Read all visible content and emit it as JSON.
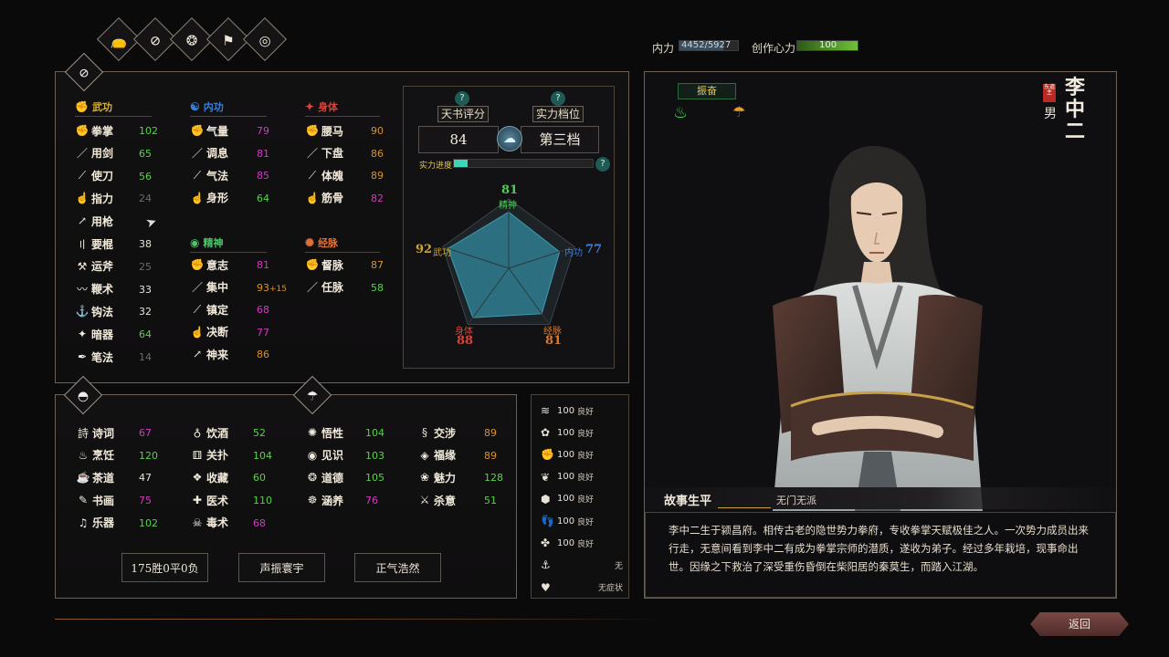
{
  "top_tabs": [
    {
      "icon": "pouch-icon",
      "glyph": "👝"
    },
    {
      "icon": "forbidden-scroll-icon",
      "glyph": "⊘"
    },
    {
      "icon": "stones-icon",
      "glyph": "❂"
    },
    {
      "icon": "flags-icon",
      "glyph": "⚑"
    },
    {
      "icon": "target-icon",
      "glyph": "◎"
    }
  ],
  "resources": {
    "neili_label": "内力",
    "neili_value": "4452/5927",
    "neili_fraction": 0.75,
    "creation_label": "创作心力",
    "creation_value": "100",
    "creation_fraction": 1.0
  },
  "martial": {
    "title": "武功",
    "items": [
      {
        "name": "拳掌",
        "value": "102",
        "tone": "g"
      },
      {
        "name": "用剑",
        "value": "65",
        "tone": "g"
      },
      {
        "name": "使刀",
        "value": "56",
        "tone": "g"
      },
      {
        "name": "指力",
        "value": "24",
        "tone": "d"
      },
      {
        "name": "用枪",
        "value": "",
        "tone": "d"
      },
      {
        "name": "要棍",
        "value": "38",
        "tone": "w"
      },
      {
        "name": "运斧",
        "value": "25",
        "tone": "d"
      },
      {
        "name": "鞭术",
        "value": "33",
        "tone": "w"
      },
      {
        "name": "钩法",
        "value": "32",
        "tone": "w"
      },
      {
        "name": "暗器",
        "value": "64",
        "tone": "g"
      },
      {
        "name": "笔法",
        "value": "14",
        "tone": "d"
      }
    ]
  },
  "neigong": {
    "title": "内功",
    "items": [
      {
        "name": "气量",
        "value": "79",
        "tone": "p"
      },
      {
        "name": "调息",
        "value": "81",
        "tone": "p"
      },
      {
        "name": "气法",
        "value": "85",
        "tone": "p"
      },
      {
        "name": "身形",
        "value": "64",
        "tone": "g"
      }
    ]
  },
  "jingshen": {
    "title": "精神",
    "items": [
      {
        "name": "意志",
        "value": "81",
        "tone": "p"
      },
      {
        "name": "集中",
        "value": "93",
        "bonus": "+15",
        "tone": "o"
      },
      {
        "name": "镇定",
        "value": "68",
        "tone": "p"
      },
      {
        "name": "决断",
        "value": "77",
        "tone": "p"
      },
      {
        "name": "神来",
        "value": "86",
        "tone": "o"
      }
    ]
  },
  "shenti": {
    "title": "身体",
    "items": [
      {
        "name": "腰马",
        "value": "90",
        "tone": "o"
      },
      {
        "name": "下盘",
        "value": "86",
        "tone": "o"
      },
      {
        "name": "体魄",
        "value": "89",
        "tone": "o"
      },
      {
        "name": "筋骨",
        "value": "82",
        "tone": "p"
      }
    ]
  },
  "jingmai": {
    "title": "经脉",
    "items": [
      {
        "name": "督脉",
        "value": "87",
        "tone": "o"
      },
      {
        "name": "任脉",
        "value": "58",
        "tone": "g"
      }
    ]
  },
  "rating": {
    "tianshu_label": "天书评分",
    "tianshu_value": "84",
    "tier_label": "实力档位",
    "tier_value": "第三档",
    "progress_label": "实力进度",
    "progress_fraction": 0.1,
    "help": "?"
  },
  "radar": {
    "top_value": "81",
    "top_label": "精神",
    "right_label": "内功",
    "right_value": "77",
    "left_value": "92",
    "left_label": "武功",
    "bl_label": "身体",
    "bl_value": "88",
    "br_label": "经脉",
    "br_value": "81",
    "values": [
      81,
      77,
      81,
      88,
      92
    ]
  },
  "life_skills": [
    {
      "name": "诗词",
      "value": "67",
      "tone": "p",
      "icon": "poetry-icon",
      "glyph": "詩"
    },
    {
      "name": "烹饪",
      "value": "120",
      "tone": "g",
      "icon": "cooking-icon",
      "glyph": "♨"
    },
    {
      "name": "茶道",
      "value": "47",
      "tone": "w",
      "icon": "tea-icon",
      "glyph": "☕"
    },
    {
      "name": "书画",
      "value": "75",
      "tone": "p",
      "icon": "painting-icon",
      "glyph": "✎"
    },
    {
      "name": "乐器",
      "value": "102",
      "tone": "g",
      "icon": "instrument-icon",
      "glyph": "♫"
    },
    {
      "name": "饮酒",
      "value": "52",
      "tone": "g",
      "icon": "wine-icon",
      "glyph": "♁"
    },
    {
      "name": "关扑",
      "value": "104",
      "tone": "g",
      "icon": "gamble-icon",
      "glyph": "⚅"
    },
    {
      "name": "收藏",
      "value": "60",
      "tone": "g",
      "icon": "collect-icon",
      "glyph": "❖"
    },
    {
      "name": "医术",
      "value": "110",
      "tone": "g",
      "icon": "medicine-icon",
      "glyph": "✚"
    },
    {
      "name": "毒术",
      "value": "68",
      "tone": "p",
      "icon": "poison-icon",
      "glyph": "☠"
    },
    {
      "name": "悟性",
      "value": "104",
      "tone": "g",
      "icon": "insight-icon",
      "glyph": "✺"
    },
    {
      "name": "见识",
      "value": "103",
      "tone": "g",
      "icon": "knowledge-icon",
      "glyph": "◉"
    },
    {
      "name": "道德",
      "value": "105",
      "tone": "g",
      "icon": "morality-icon",
      "glyph": "❂"
    },
    {
      "name": "涵养",
      "value": "76",
      "tone": "p",
      "icon": "cultivation-icon",
      "glyph": "☸"
    },
    {
      "name": "交涉",
      "value": "89",
      "tone": "o",
      "icon": "negotiate-icon",
      "glyph": "§"
    },
    {
      "name": "福缘",
      "value": "89",
      "tone": "o",
      "icon": "fortune-icon",
      "glyph": "◈"
    },
    {
      "name": "魅力",
      "value": "128",
      "tone": "g",
      "icon": "charm-icon",
      "glyph": "❀"
    },
    {
      "name": "杀意",
      "value": "51",
      "tone": "g",
      "icon": "killing-icon",
      "glyph": "⚔"
    }
  ],
  "buttons": {
    "record": "175胜0平0负",
    "fame": "声振寰宇",
    "righteous": "正气浩然"
  },
  "moods": [
    {
      "value": "100",
      "state": "良好",
      "icon": "wind-icon",
      "glyph": "≋"
    },
    {
      "value": "100",
      "state": "良好",
      "icon": "lotus-icon",
      "glyph": "✿"
    },
    {
      "value": "100",
      "state": "良好",
      "icon": "arm-icon",
      "glyph": "✊"
    },
    {
      "value": "100",
      "state": "良好",
      "icon": "grass-icon",
      "glyph": "❦"
    },
    {
      "value": "100",
      "state": "良好",
      "icon": "stone-icon",
      "glyph": "⬢"
    },
    {
      "value": "100",
      "state": "良好",
      "icon": "foot-icon",
      "glyph": "👣"
    },
    {
      "value": "100",
      "state": "良好",
      "icon": "flower-icon",
      "glyph": "✤"
    },
    {
      "value": "",
      "state": "无",
      "icon": "anchor-icon",
      "glyph": "⚓"
    },
    {
      "value": "",
      "state": "无症状",
      "icon": "heart-icon",
      "glyph": "♥"
    }
  ],
  "character": {
    "status_badge": "振奋",
    "name_chars": [
      "李",
      "中",
      "二"
    ],
    "seal": "东道主",
    "gender": "男",
    "bio_title": "故事生平",
    "sect": "无门无派",
    "bio_text": "李中二生于颍昌府。相传古老的隐世势力拳府，专收拳掌天赋极佳之人。一次势力成员出来行走，无意间看到李中二有成为拳掌宗师的潜质，遂收为弟子。经过多年栽培，现事命出世。因缘之下救治了深受重伤昏倒在柴阳居的秦莫生，而踏入江湖。"
  },
  "back_button": "返回",
  "colors": {
    "accent_gold": "#c9a04a",
    "green": "#59d24a",
    "purple": "#d23ac0",
    "orange": "#d99226",
    "teal": "#2f7f8f"
  }
}
